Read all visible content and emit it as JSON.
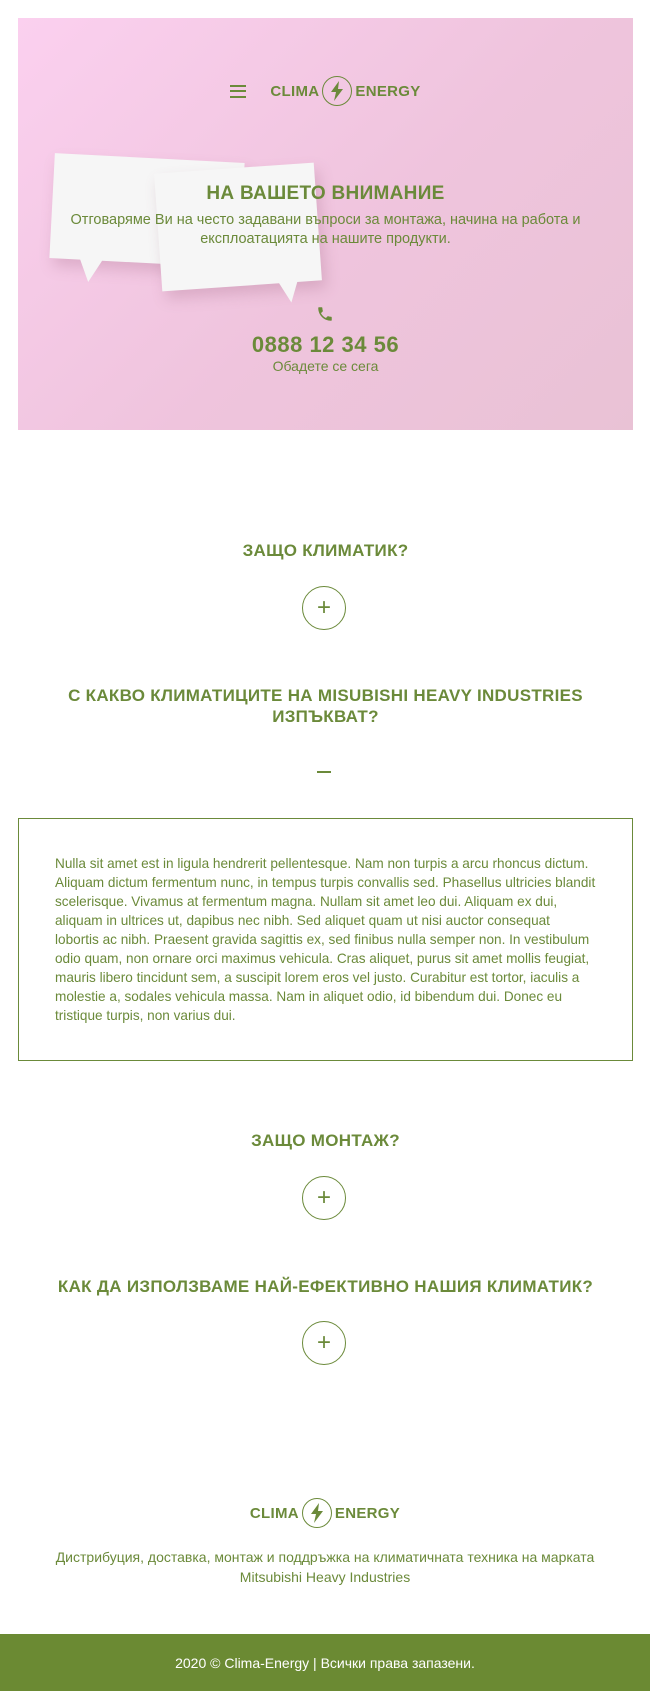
{
  "colors": {
    "accent": "#6b8a3a",
    "footer_bg": "#6b8a33",
    "hero_bg": "#f2c8e0"
  },
  "header": {
    "menu_icon": "hamburger-icon",
    "logo": {
      "left": "CLIMA",
      "right": "ENERGY",
      "icon": "lightning-bolt-icon"
    }
  },
  "hero": {
    "title": "НА ВАШЕТО ВНИМАНИЕ",
    "subtitle": "Отговаряме Ви на често задавани въпроси за монтажа, начина на работа и експлоатацията на нашите продукти.",
    "phone_icon": "phone-icon",
    "phone": "0888 12 34 56",
    "phone_cta": "Обадете се сега"
  },
  "faq": [
    {
      "question": "ЗАЩО КЛИМАТИК?",
      "toggle": "+",
      "expanded": false
    },
    {
      "question": "С КАКВО КЛИМАТИЦИТЕ НА MISUBISHI HEAVY INDUSTRIES ИЗПЪКВАТ?",
      "toggle": "–",
      "expanded": true,
      "answer": "Nulla sit amet est in ligula hendrerit pellentesque. Nam non turpis a arcu rhoncus dictum. Aliquam dictum fermentum nunc, in tempus turpis convallis sed. Phasellus ultricies blandit scelerisque. Vivamus at fermentum magna. Nullam sit amet leo dui. Aliquam ex dui, aliquam in ultrices ut, dapibus nec nibh. Sed aliquet quam ut nisi auctor consequat lobortis ac nibh. Praesent gravida sagittis ex, sed finibus nulla semper non. In vestibulum odio quam, non ornare orci maximus vehicula. Cras aliquet, purus sit amet mollis feugiat, mauris libero tincidunt sem, a suscipit lorem eros vel justo. Curabitur est tortor, iaculis a molestie a, sodales vehicula massa. Nam in aliquet odio, id bibendum dui. Donec eu tristique turpis, non varius dui."
    },
    {
      "question": "ЗАЩО МОНТАЖ?",
      "toggle": "+",
      "expanded": false
    },
    {
      "question": "КАК ДА ИЗПОЛЗВАМЕ НАЙ-ЕФЕКТИВНО НАШИЯ КЛИМАТИК?",
      "toggle": "+",
      "expanded": false
    }
  ],
  "footer": {
    "logo": {
      "left": "CLIMA",
      "right": "ENERGY",
      "icon": "lightning-bolt-icon"
    },
    "description": "Дистрибуция, доставка, монтаж и поддръжка на климатичната техника на марката Mitsubishi Heavy Industries",
    "copyright": "2020 © Clima-Energy | Всички права запазени."
  }
}
